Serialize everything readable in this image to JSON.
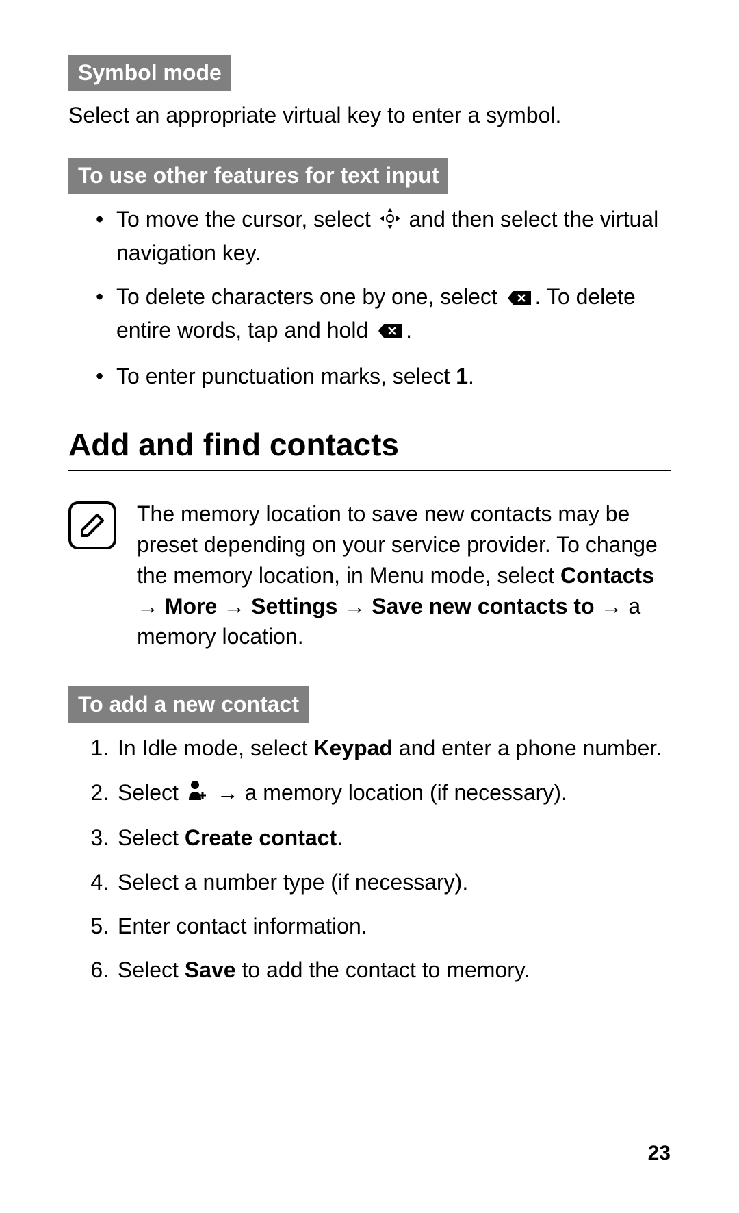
{
  "sec1": {
    "head": "Symbol mode",
    "body": "Select an appropriate virtual key to enter a symbol."
  },
  "sec2": {
    "head": "To use other features for text input",
    "b1a": "To move the cursor, select ",
    "b1b": " and then select the virtual navigation key.",
    "b2a": "To delete characters one by one, select ",
    "b2b": ". To delete entire words, tap and hold ",
    "b2c": ".",
    "b3a": "To enter punctuation marks, select ",
    "b3bold": "1",
    "b3b": "."
  },
  "h1": "Add and find contacts",
  "note": {
    "a": "The memory location to save new contacts may be preset depending on your service provider. To change the memory location, in Menu mode, select ",
    "bold1": "Contacts",
    "arr": " → ",
    "bold2": "More",
    "bold3": "Settings",
    "bold4": "Save new contacts to",
    "b": " → a memory location."
  },
  "sec3": {
    "head": "To add a new contact",
    "s1a": "In Idle mode, select ",
    "s1bold": "Keypad",
    "s1b": " and enter a phone number.",
    "s2a": "Select ",
    "s2b": " → a memory location (if necessary).",
    "s3a": "Select ",
    "s3bold": "Create contact",
    "s3b": ".",
    "s4": "Select a number type (if necessary).",
    "s5": "Enter contact information.",
    "s6a": "Select ",
    "s6bold": "Save",
    "s6b": " to add the contact to memory."
  },
  "page": "23"
}
